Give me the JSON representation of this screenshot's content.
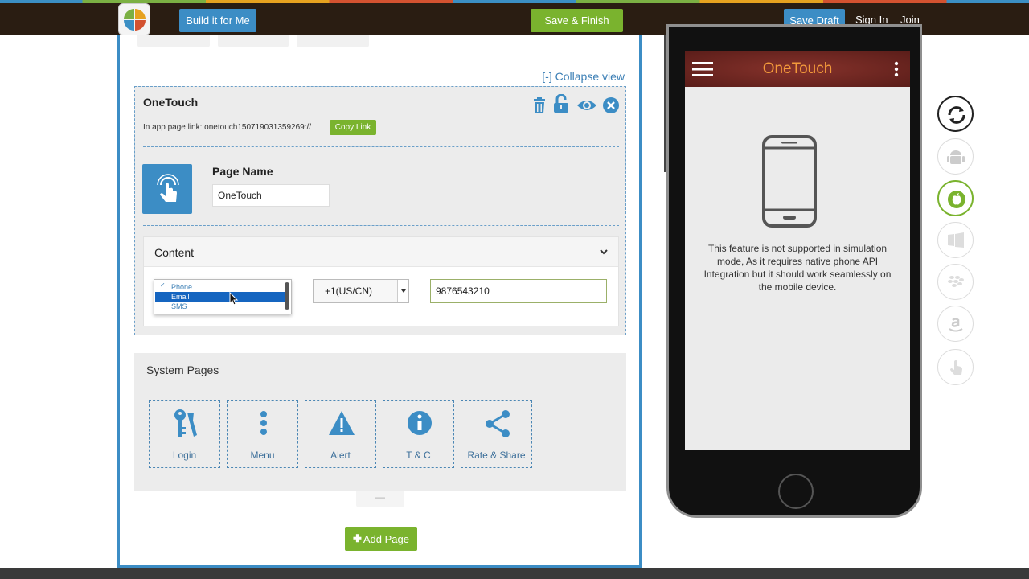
{
  "topbar": {
    "build_label": "Build it for Me",
    "save_finish_label": "Save & Finish",
    "save_draft_label": "Save Draft",
    "sign_in_label": "Sign In",
    "join_label": "Join"
  },
  "editor": {
    "collapse_label": "[-] Collapse view",
    "page_card": {
      "title": "OneTouch",
      "link_text": "In app page link: onetouch150719031359269://",
      "copy_link_label": "Copy Link",
      "page_name_label": "Page Name",
      "page_name_value": "OneTouch",
      "content": {
        "title": "Content",
        "contact_type_options": [
          "Phone",
          "Email",
          "SMS"
        ],
        "contact_type_checked": "Phone",
        "contact_type_highlighted": "Email",
        "country_code": "+1(US/CN)",
        "phone_number": "9876543210"
      }
    },
    "system_pages": {
      "title": "System Pages",
      "items": [
        {
          "label": "Login",
          "icon": "keys-icon"
        },
        {
          "label": "Menu",
          "icon": "menu-dots-icon"
        },
        {
          "label": "Alert",
          "icon": "warning-icon"
        },
        {
          "label": "T & C",
          "icon": "info-icon"
        },
        {
          "label": "Rate & Share",
          "icon": "share-icon"
        }
      ]
    },
    "add_page_label": "Add Page",
    "drag_handle_glyph": "—"
  },
  "preview": {
    "app_title": "OneTouch",
    "message": "This feature is not supported in simulation mode, As it requires native phone API Integration but it should work seamlessly on the mobile device."
  },
  "colors": {
    "brand_blue": "#3c8dc5",
    "brand_green": "#7ab32e",
    "topbar_bg": "#2a1d12",
    "app_title_orange": "#f39a3b",
    "active_platform": "#7ab32e"
  },
  "platforms": [
    "refresh-icon",
    "android-icon",
    "apple-icon",
    "windows-icon",
    "blackberry-icon",
    "amazon-icon",
    "touch-icon"
  ],
  "active_platform": "apple-icon"
}
